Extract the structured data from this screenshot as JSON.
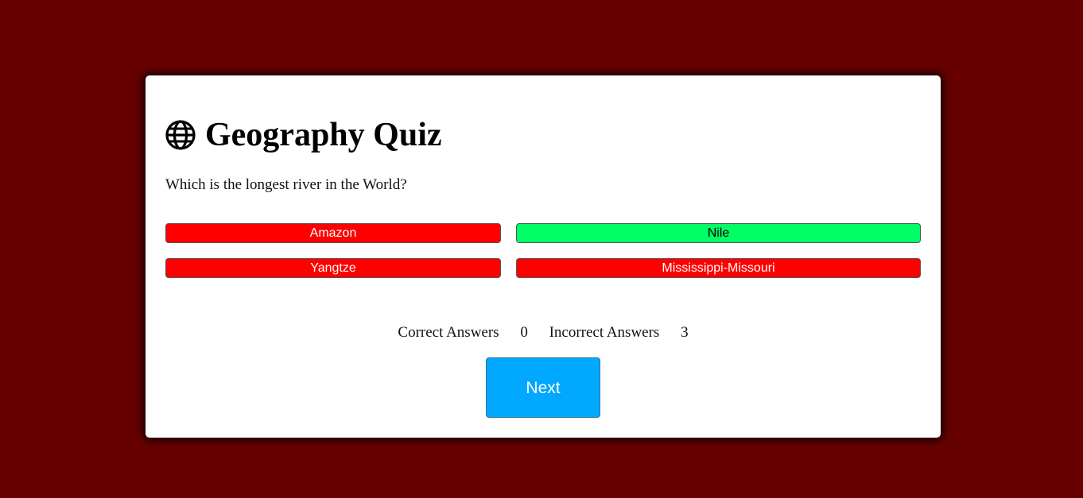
{
  "page": {
    "background_color": "#660000"
  },
  "quiz": {
    "title": "Geography Quiz",
    "title_icon": "globe-icon",
    "question": "Which is the longest river in the World?",
    "answers": [
      {
        "label": "Amazon",
        "state": "incorrect",
        "color": "#ff0000"
      },
      {
        "label": "Nile",
        "state": "correct",
        "color": "#00ff66"
      },
      {
        "label": "Yangtze",
        "state": "incorrect",
        "color": "#ff0000"
      },
      {
        "label": "Mississippi-Missouri",
        "state": "incorrect",
        "color": "#ff0000"
      }
    ],
    "score": {
      "correct_label": "Correct Answers",
      "correct_count": "0",
      "incorrect_label": "Incorrect Answers",
      "incorrect_count": "3"
    },
    "next_label": "Next",
    "next_color": "#00a8ff"
  }
}
